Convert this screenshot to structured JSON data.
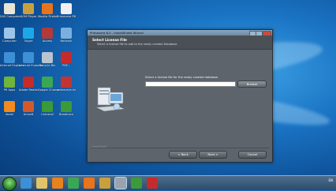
{
  "desktop": {
    "icons": [
      {
        "label": "SAS Computer...",
        "icon": "folder-icon",
        "color": "#e9e4d6"
      },
      {
        "label": "GOM Player",
        "icon": "gom-player-icon",
        "color": "#c8a040"
      },
      {
        "label": "Mozilla Firefox",
        "icon": "firefox-icon",
        "color": "#e8741c"
      },
      {
        "label": "Primavera P6",
        "icon": "document-icon",
        "color": "#f0f0f0"
      },
      {
        "label": "Computer",
        "icon": "computer-icon",
        "color": "#9bc4e8"
      },
      {
        "label": "Skype",
        "icon": "skype-icon",
        "color": "#1ea7e6"
      },
      {
        "label": "Access",
        "icon": "access-icon",
        "color": "#b23a3a"
      },
      {
        "label": "Network",
        "icon": "network-icon",
        "color": "#7ab0e0"
      },
      {
        "label": "Internet Explorer",
        "icon": "ie-icon",
        "color": "#3d8fd6"
      },
      {
        "label": "Internet Explorer",
        "icon": "ie-icon",
        "color": "#3d8fd6"
      },
      {
        "label": "Recycle Bin",
        "icon": "recycle-bin-icon",
        "color": "#b8c4d0"
      },
      {
        "label": "PDF...",
        "icon": "pdf-icon",
        "color": "#c62b2b"
      },
      {
        "label": "P6 Apps",
        "icon": "p6-icon",
        "color": "#6fb43c"
      },
      {
        "label": "Adobe Reader",
        "icon": "adobe-reader-icon",
        "color": "#c62b2b"
      },
      {
        "label": "Google Chrome",
        "icon": "chrome-icon",
        "color": "#3aa757"
      },
      {
        "label": "primavera.ini",
        "icon": "file-icon",
        "color": "#c23434"
      },
      {
        "label": "Avast",
        "icon": "avast-icon",
        "color": "#f28a1e"
      },
      {
        "label": "Arcsoft",
        "icon": "media-icon",
        "color": "#d25a2a"
      },
      {
        "label": "Uninstall",
        "icon": "green-app-icon",
        "color": "#3a9a38"
      },
      {
        "label": "Bandicam",
        "icon": "bandicam-icon",
        "color": "#3c9a3a"
      }
    ]
  },
  "wizard": {
    "window_title": "Primavera 6.0 - InstallShield Wizard",
    "header_title": "Select License File",
    "header_subtitle": "Select a license file to add to the newly created Database.",
    "prompt": "Select a license file for the newly created database",
    "path_value": "",
    "browse_label": "Browse",
    "brand": "InstallShield",
    "back_label": "< Back",
    "next_label": "Next >",
    "cancel_label": "Cancel"
  },
  "taskbar": {
    "apps": [
      {
        "icon": "ie-icon",
        "color": "#3d8fd6"
      },
      {
        "icon": "explorer-folder-icon",
        "color": "#e3c36a"
      },
      {
        "icon": "media-player-icon",
        "color": "#e8821e"
      },
      {
        "icon": "chrome-icon",
        "color": "#3aa757"
      },
      {
        "icon": "firefox-icon",
        "color": "#e8741c"
      },
      {
        "icon": "gom-player-icon",
        "color": "#c8a040"
      },
      {
        "icon": "installer-icon",
        "color": "#9aa4ae"
      },
      {
        "icon": "bandicam-icon",
        "color": "#3c9a3a"
      },
      {
        "icon": "acrobat-icon",
        "color": "#c62b2b"
      }
    ],
    "language": "EN",
    "time": "",
    "date": ""
  }
}
